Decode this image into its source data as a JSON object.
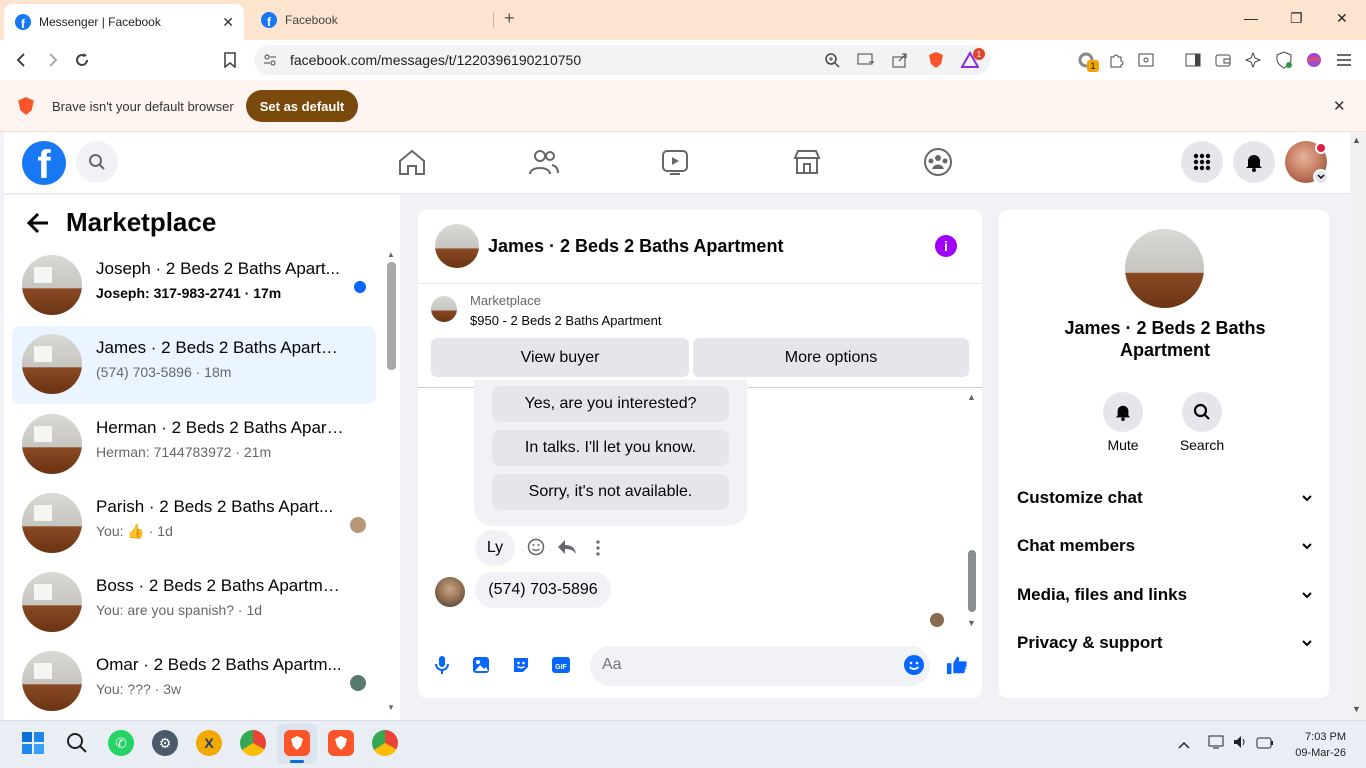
{
  "browser": {
    "tabs": [
      {
        "label": "Messenger | Facebook",
        "active": true
      },
      {
        "label": "Facebook",
        "active": false
      }
    ],
    "url": "facebook.com/messages/t/1220396190210750",
    "infobar_text": "Brave isn't your default browser",
    "set_default_label": "Set as default",
    "notif_badge": "1",
    "ext_badge": "1"
  },
  "header": {
    "logo_letter": "f"
  },
  "sidebar": {
    "title": "Marketplace",
    "conversations": [
      {
        "name": "Joseph · 2 Beds 2 Baths Apart...",
        "sub": "Joseph: 317-983-2741 · 17m",
        "unread": true
      },
      {
        "name": "James · 2 Beds 2 Baths Apartment",
        "sub": "(574) 703-5896 · 18m",
        "selected": true
      },
      {
        "name": "Herman · 2 Beds 2 Baths Apartm...",
        "sub": "Herman: 7144783972 · 21m"
      },
      {
        "name": "Parish · 2 Beds 2 Baths Apart...",
        "sub": "You: 👍 · 1d"
      },
      {
        "name": "Boss · 2 Beds 2 Baths Apartment",
        "sub": "You: are you spanish? · 1d"
      },
      {
        "name": "Omar · 2 Beds 2 Baths Apartm...",
        "sub": "You: ??? · 3w"
      }
    ]
  },
  "chat": {
    "title": "James · 2 Beds 2 Baths Apartment",
    "listing_label": "Marketplace",
    "listing_price": "$950 - 2 Beds 2 Baths Apartment",
    "view_buyer_label": "View buyer",
    "more_options_label": "More options",
    "quick_replies": [
      "Yes, are you interested?",
      "In talks. I'll let you know.",
      "Sorry, it's not available."
    ],
    "reply_text": "Ly",
    "incoming_message": "(574) 703-5896",
    "composer_placeholder": "Aa"
  },
  "details": {
    "name": "James · 2 Beds 2 Baths Apartment",
    "mute_label": "Mute",
    "search_label": "Search",
    "sections": [
      "Customize chat",
      "Chat members",
      "Media, files and links",
      "Privacy & support"
    ]
  },
  "taskbar": {
    "time": "7:03 PM",
    "date": "09-Mar-26"
  },
  "colors": {
    "brand": "#1877f2",
    "messenger_blue": "#0866ff",
    "info_purple": "#a100ff",
    "set_default_bg": "#7a4a0c"
  }
}
